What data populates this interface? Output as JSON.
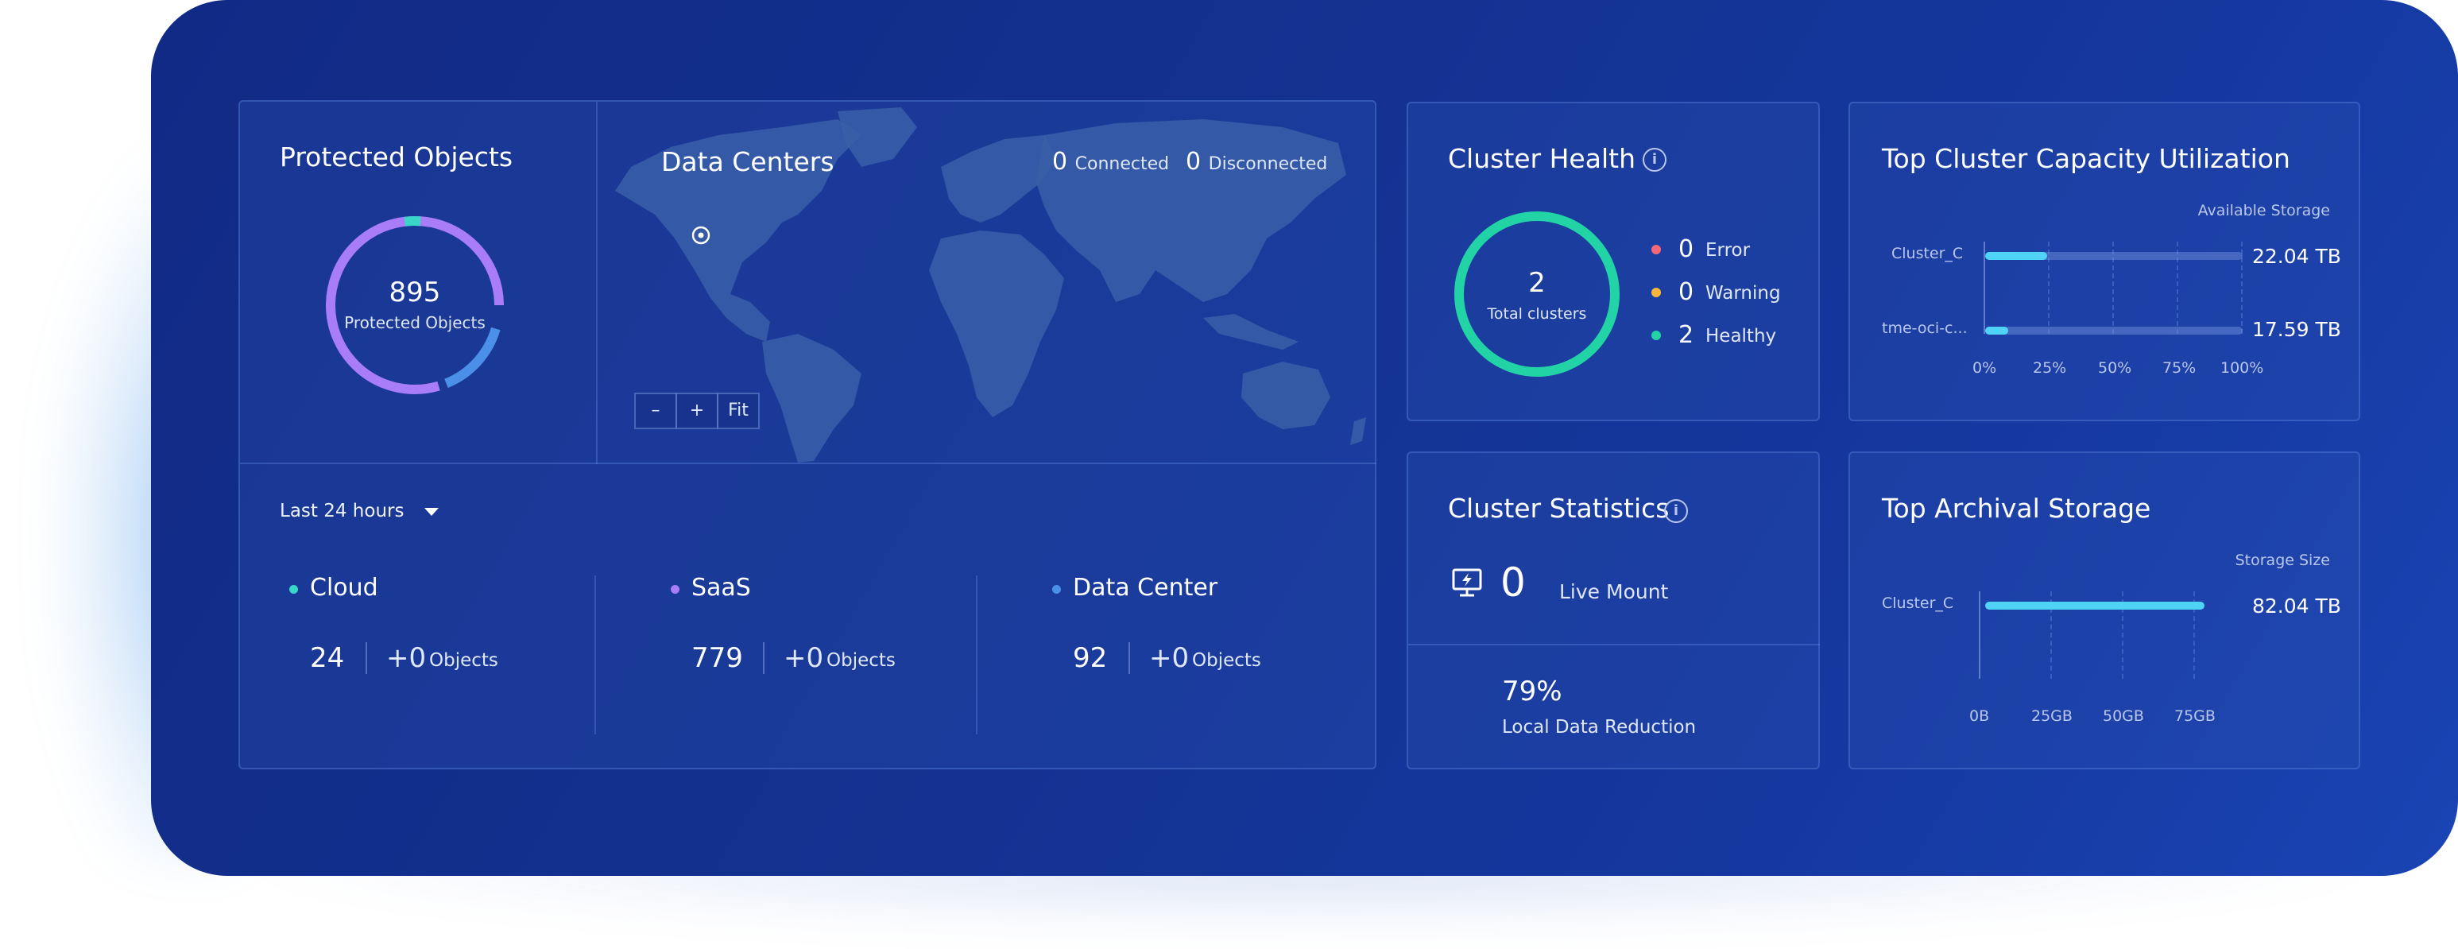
{
  "protected_objects": {
    "title": "Protected Objects",
    "count": "895",
    "count_label": "Protected Objects",
    "ring_segments": [
      {
        "name": "SaaS",
        "color": "#a97cf8",
        "value": 779
      },
      {
        "name": "Data Center",
        "color": "#4a90e8",
        "value": 92
      },
      {
        "name": "Cloud",
        "color": "#3ad6c8",
        "value": 24
      }
    ]
  },
  "data_centers": {
    "title": "Data Centers",
    "connected_count": "0",
    "connected_label": "Connected",
    "disconnected_count": "0",
    "disconnected_label": "Disconnected",
    "zoom_out_label": "–",
    "zoom_in_label": "+",
    "fit_label": "Fit"
  },
  "time_filter": {
    "label": "Last 24 hours"
  },
  "categories": [
    {
      "name": "Cloud",
      "dot_color": "#3ad6c8",
      "count": "24",
      "delta": "+0",
      "unit": "Objects"
    },
    {
      "name": "SaaS",
      "dot_color": "#a97cf8",
      "count": "779",
      "delta": "+0",
      "unit": "Objects"
    },
    {
      "name": "Data Center",
      "dot_color": "#4a90e8",
      "count": "92",
      "delta": "+0",
      "unit": "Objects"
    }
  ],
  "cluster_health": {
    "title": "Cluster Health",
    "total": "2",
    "total_label": "Total clusters",
    "ring_color": "#22d3a6",
    "statuses": [
      {
        "label": "Error",
        "count": "0",
        "color": "#f4687a"
      },
      {
        "label": "Warning",
        "count": "0",
        "color": "#f5b73b"
      },
      {
        "label": "Healthy",
        "count": "2",
        "color": "#22d3a6"
      }
    ]
  },
  "capacity": {
    "title": "Top Cluster Capacity Utilization",
    "legend": "Available Storage",
    "rows": [
      {
        "name": "Cluster_C",
        "percent": 24,
        "value": "22.04 TB"
      },
      {
        "name": "tme-oci-c...",
        "percent": 9,
        "value": "17.59 TB"
      }
    ],
    "ticks": [
      "0%",
      "25%",
      "50%",
      "75%",
      "100%"
    ]
  },
  "cluster_statistics": {
    "title": "Cluster Statistics",
    "live_mount_count": "0",
    "live_mount_label": "Live Mount",
    "reduction_value": "79%",
    "reduction_label": "Local Data Reduction"
  },
  "archival": {
    "title": "Top Archival Storage",
    "legend": "Storage Size",
    "rows": [
      {
        "name": "Cluster_C",
        "gb": 82.04,
        "value": "82.04 TB"
      }
    ],
    "ticks": [
      "0B",
      "25GB",
      "50GB",
      "75GB"
    ]
  },
  "colors": {
    "accent_bar": "#4fd3f7",
    "background": "#13318f"
  }
}
